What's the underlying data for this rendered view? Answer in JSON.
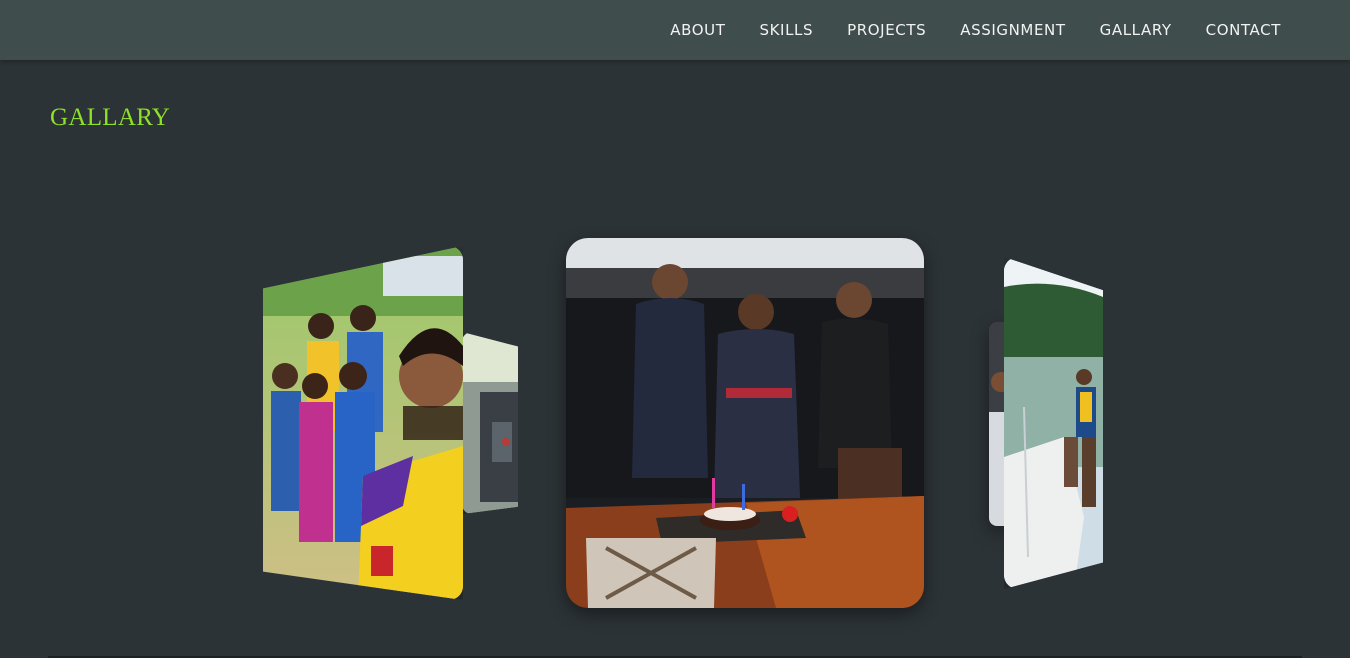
{
  "nav": {
    "items": [
      {
        "label": "ABOUT"
      },
      {
        "label": "SKILLS"
      },
      {
        "label": "PROJECTS"
      },
      {
        "label": "ASSIGNMENT"
      },
      {
        "label": "GALLARY"
      },
      {
        "label": "CONTACT"
      }
    ]
  },
  "gallery": {
    "title": "GALLARY"
  },
  "colors": {
    "background": "#2c3336",
    "navbar": "#3f4d4c",
    "title": "#8ee028",
    "nav_text": "#f2f2f2"
  }
}
